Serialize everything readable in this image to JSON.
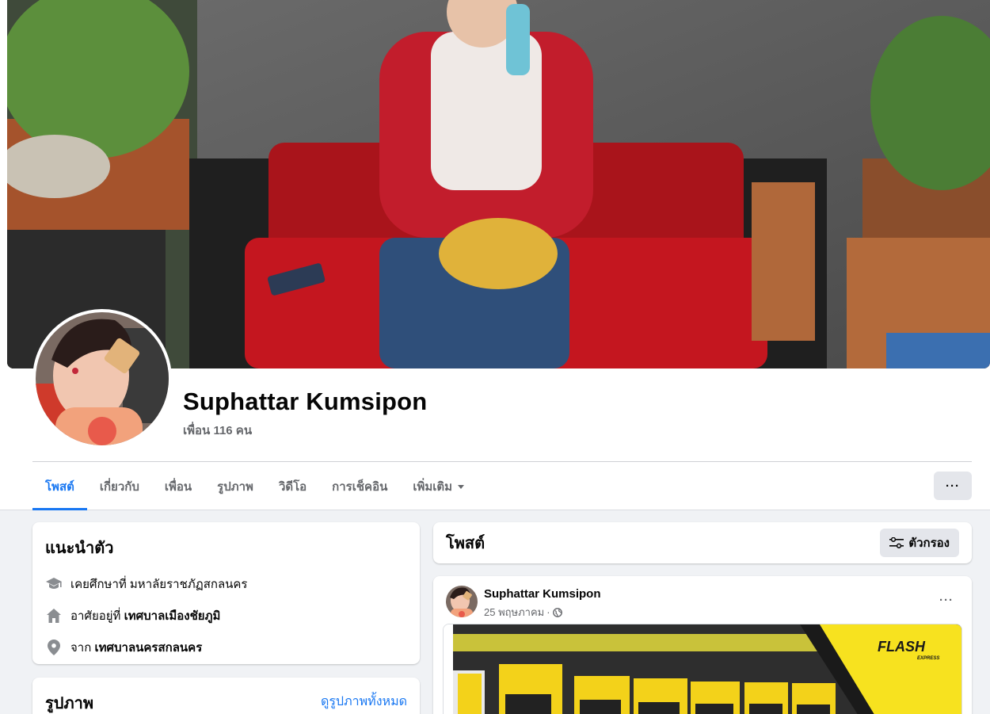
{
  "profile": {
    "name": "Suphattar Kumsipon",
    "friends": "เพื่อน 116 คน"
  },
  "tabs": [
    {
      "label": "โพสต์",
      "active": true
    },
    {
      "label": "เกี่ยวกับ"
    },
    {
      "label": "เพื่อน"
    },
    {
      "label": "รูปภาพ"
    },
    {
      "label": "วิดีโอ"
    },
    {
      "label": "การเช็คอิน"
    },
    {
      "label": "เพิ่มเติม"
    }
  ],
  "more_button": "···",
  "intro": {
    "title": "แนะนำตัว",
    "items": [
      {
        "icon": "graduation-cap-icon",
        "prefix": "เคยศึกษาที่ มหาลัยราชภัฏสกลนคร",
        "bold": ""
      },
      {
        "icon": "home-icon",
        "prefix": "อาศัยอยู่ที่ ",
        "bold": "เทศบาลเมืองชัยภูมิ"
      },
      {
        "icon": "location-pin-icon",
        "prefix": "จาก ",
        "bold": "เทศบาลนครสกลนคร"
      }
    ]
  },
  "photos": {
    "title": "รูปภาพ",
    "see_all": "ดูรูปภาพทั้งหมด"
  },
  "posts": {
    "title": "โพสต์",
    "filter_label": "ตัวกรอง"
  },
  "post": {
    "author": "Suphattar Kumsipon",
    "date": "25 พฤษภาคม",
    "dot": "·",
    "privacy_icon": "globe-icon",
    "menu": "···",
    "image_brand": "FLASH",
    "image_brand_sub": "EXPRESS"
  },
  "colors": {
    "accent": "#1877f2",
    "secondary_text": "#65676b",
    "background": "#f0f2f5",
    "button_bg": "#e4e6eb"
  }
}
